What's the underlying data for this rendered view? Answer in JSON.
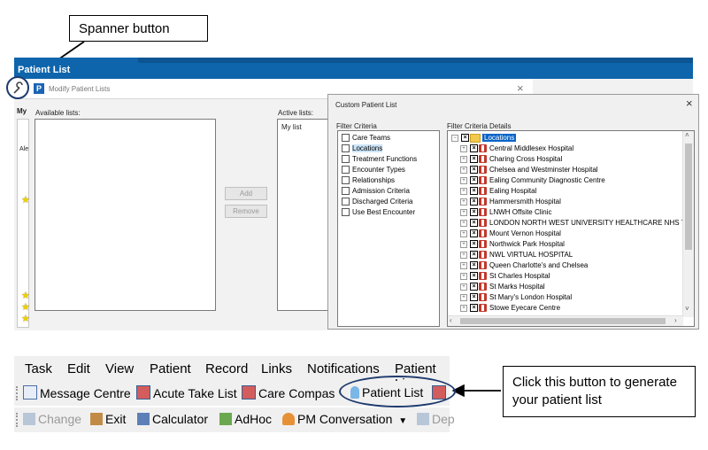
{
  "annotations": {
    "spanner_callout": "Spanner button",
    "patient_list_callout_line1": "Click this button to generate",
    "patient_list_callout_line2": "your patient list"
  },
  "app": {
    "title": "Patient List",
    "my_label": "My",
    "ale_label": "Ale"
  },
  "modify_dialog": {
    "title": "Modify Patient Lists",
    "available_label": "Available lists:",
    "active_label": "Active lists:",
    "active_items": [
      "My list"
    ],
    "add_button": "Add",
    "remove_button": "Remove",
    "close_glyph": "×"
  },
  "custom_dialog": {
    "title": "Custom Patient List",
    "close_glyph": "×",
    "filter_criteria_label": "Filter Criteria",
    "filter_details_label": "Filter Criteria Details",
    "criteria": [
      "Care Teams",
      "Locations",
      "Treatment Functions",
      "Encounter Types",
      "Relationships",
      "Admission Criteria",
      "Discharged Criteria",
      "Use Best Encounter"
    ],
    "selected_criterion": "Locations",
    "tree_root": "Locations",
    "locations": [
      "Central Middlesex Hospital",
      "Charing Cross Hospital",
      "Chelsea and Westminster Hospital",
      "Ealing Community Diagnostic Centre",
      "Ealing Hospital",
      "Hammersmith Hospital",
      "LNWH Offsite Clinic",
      "LONDON NORTH WEST UNIVERSITY HEALTHCARE NHS TRU",
      "Mount Vernon Hospital",
      "Northwick Park Hospital",
      "NWL VIRTUAL HOSPITAL",
      "Queen Charlotte's and Chelsea",
      "St Charles Hospital",
      "St Marks Hospital",
      "St Mary's London Hospital",
      "Stowe Eyecare Centre"
    ]
  },
  "menubar": {
    "items": [
      "Task",
      "Edit",
      "View",
      "Patient",
      "Record",
      "Links",
      "Notifications",
      "Patient Lis"
    ]
  },
  "toolbar1": {
    "items": [
      "Message Centre",
      "Acute Take List",
      "Care Compas",
      "Patient List"
    ]
  },
  "toolbar2": {
    "items": [
      "Change",
      "Exit",
      "Calculator",
      "AdHoc",
      "PM Conversation",
      "Dep"
    ]
  },
  "colors": {
    "brand_blue": "#0e65ab",
    "selection_blue": "#0a64c8",
    "highlight_bg": "#cce4f7"
  }
}
